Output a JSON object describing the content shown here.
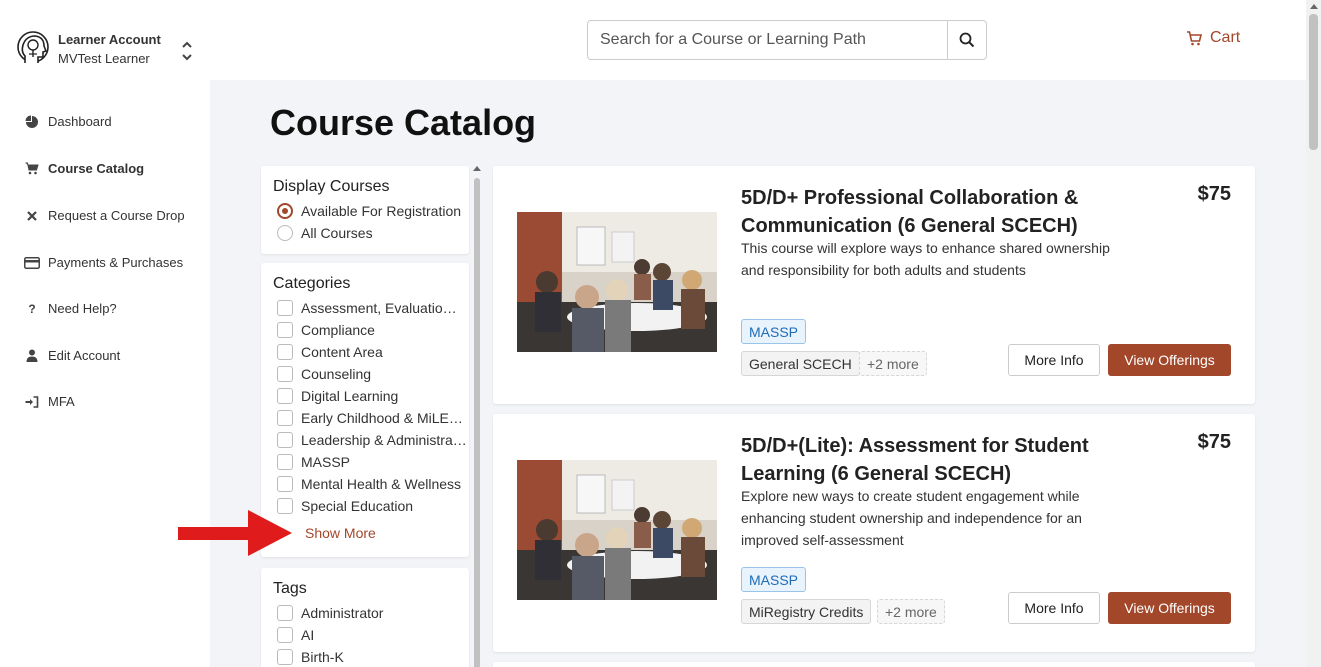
{
  "account": {
    "name": "Learner Account",
    "sub": "MVTest Learner"
  },
  "search": {
    "placeholder": "Search for a Course or Learning Path"
  },
  "cart": {
    "label": "Cart"
  },
  "sidebar": {
    "items": [
      {
        "label": "Dashboard",
        "icon": "pie-chart-icon"
      },
      {
        "label": "Course Catalog",
        "icon": "cart-icon",
        "active": true
      },
      {
        "label": "Request a Course Drop",
        "icon": "x-icon"
      },
      {
        "label": "Payments & Purchases",
        "icon": "credit-card-icon"
      },
      {
        "label": "Need Help?",
        "icon": "question-icon"
      },
      {
        "label": "Edit Account",
        "icon": "user-icon"
      },
      {
        "label": "MFA",
        "icon": "sign-in-icon"
      }
    ]
  },
  "page": {
    "title": "Course Catalog"
  },
  "display_courses": {
    "title": "Display Courses",
    "options": [
      {
        "label": "Available For Registration",
        "selected": true
      },
      {
        "label": "All Courses",
        "selected": false
      }
    ]
  },
  "categories": {
    "title": "Categories",
    "items": [
      "Assessment, Evaluation …",
      "Compliance",
      "Content Area",
      "Counseling",
      "Digital Learning",
      "Early Childhood & MiLEAP",
      "Leadership & Administrat…",
      "MASSP",
      "Mental Health & Wellness",
      "Special Education"
    ],
    "show_more": "Show More"
  },
  "tags": {
    "title": "Tags",
    "items": [
      "Administrator",
      "AI",
      "Birth-K"
    ]
  },
  "courses": [
    {
      "title": "5D/D+ Professional Collaboration & Communication (6 General SCECH)",
      "price": "$75",
      "description": "This course will explore ways to enhance shared ownership and responsibility for both adults and students",
      "badge": "MASSP",
      "tag": "General SCECH",
      "more": "+2 more",
      "more_info": "More Info",
      "view": "View Offerings"
    },
    {
      "title": "5D/D+(Lite): Assessment for Student Learning (6 General SCECH)",
      "price": "$75",
      "description": "Explore new ways to create student engagement while enhancing student ownership and independence for an improved self-assessment",
      "badge": "MASSP",
      "tag": "MiRegistry Credits",
      "more": "+2 more",
      "more_info": "More Info",
      "view": "View Offerings"
    }
  ],
  "colors": {
    "accent": "#a3472b",
    "badge_blue": "#1e6bb8",
    "main_bg": "#f2f4f7",
    "arrow": "#e01b1b"
  }
}
